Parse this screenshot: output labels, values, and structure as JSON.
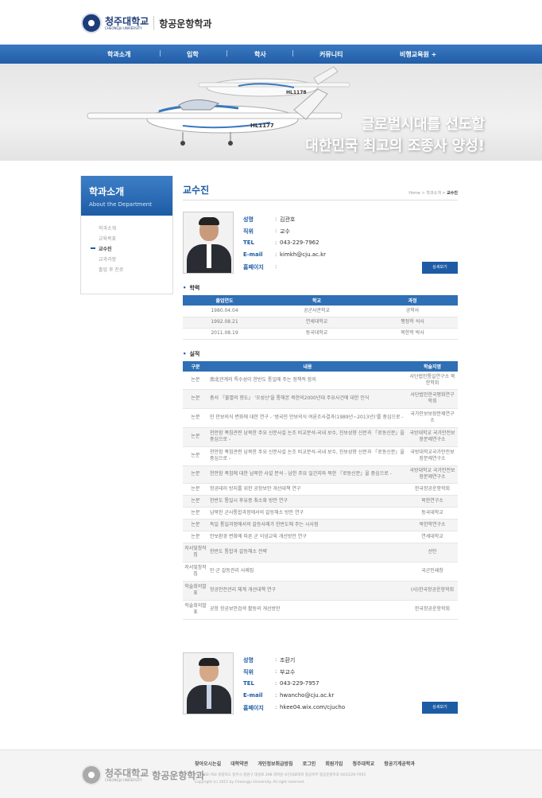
{
  "header": {
    "univ_ko": "청주대학교",
    "univ_en": "CHEONGJU UNIVERSITY",
    "dept": "항공운항학과",
    "nav": [
      "학과소개",
      "입학",
      "학사",
      "커뮤니티",
      "비행교육원 +"
    ]
  },
  "hero": {
    "line1": "글로벌시대를 선도할",
    "line2": "대한민국 최고의 조종사 양성!",
    "plane_front": "HL1177",
    "plane_back": "HL1178"
  },
  "sidebar": {
    "title": "학과소개",
    "subtitle": "About the Department",
    "items": [
      "학과소개",
      "교육목표",
      "교수진",
      "교과과정",
      "졸업 후 진로"
    ],
    "active": 2
  },
  "page": {
    "title": "교수진",
    "breadcrumb": [
      "Home",
      "학과소개",
      "교수진"
    ],
    "crumb_sep": ">"
  },
  "labels": {
    "name": "성명",
    "position": "직위",
    "tel": "TEL",
    "email": "E-mail",
    "homepage": "홈페이지",
    "detail_button": "상세보기",
    "colon": ":"
  },
  "professors": [
    {
      "name": "김관호",
      "position": "교수",
      "tel": "043-229-7962",
      "email": "kimkh@cju.ac.kr",
      "homepage": "",
      "education": {
        "title": "학력",
        "headers": [
          "졸업연도",
          "학교",
          "과정"
        ],
        "rows": [
          [
            "1980.04.04",
            "공군사관학교",
            "공학사"
          ],
          [
            "1992.08.21",
            "연세대학교",
            "행정학 석사"
          ],
          [
            "2011.08.19",
            "동국대학교",
            "북한학 박사"
          ]
        ]
      },
      "achievements": {
        "title": "실적",
        "headers": [
          "구분",
          "내용",
          "학술지명"
        ],
        "rows": [
          [
            "논문",
            "南北관계의 특수성이 한반도 통일에 주는 정책적 함의",
            "사단법인통일연구소 북한학회"
          ],
          [
            "논문",
            "총서 『불멸의 향도』 '오성산'을 통해본 북한의2000년대 주요사건에 대한 인식",
            "사단법인한국평화연구학회"
          ],
          [
            "논문",
            "민 안보의식 변화에 대한 연구 - '범국민 안보의식 여론조사결과(1989년~2013년)'를 중심으로 -",
            "국가안보보장문제연구소"
          ],
          [
            "논문",
            "천안함 폭침관련 남북한 주요 신문사설 논조 비교분석-국내 보수, 진보성향 신문과 『로동신문』을 중심으로 -",
            "국방대학교 국가안전보장문제연구소"
          ],
          [
            "논문",
            "천안함 폭침관련 남북한 주요 신문사설 논조 비교분석-국내 보수, 진보성향 신문과 『로동신문』을 중심으로 -",
            "국방대학교국가안전보장문제연구소"
          ],
          [
            "논문",
            "천안함 폭침에 대한 남북한 사설 분석 - 남한 주요 일간지와 북한 『로동신문』을 중심으로 -",
            "국방대학교 국가안전보장문제연구소"
          ],
          [
            "논문",
            "항공테러 방지를 위한 공항보안 개선대책 연구",
            "한국항공운항학회"
          ],
          [
            "논문",
            "한반도 통일시 후유증 최소화 방안 연구",
            "북한연구소"
          ],
          [
            "논문",
            "남북한 군사통합과정에서의 갈등해소 방안 연구",
            "동국대학교"
          ],
          [
            "논문",
            "독일 통일과정에서의 갈등사례가 한반도에 주는 시사점",
            "북한학연구소"
          ],
          [
            "논문",
            "안보환경 변화에 따른 군 이념교육 개선방안 연구",
            "연세대학교"
          ],
          [
            "저서및창작집",
            "한반도 통합과 갈등해소 전략",
            "선인"
          ],
          [
            "저서및창작집",
            "민·군 갈등관리 사례집",
            "국군인쇄창"
          ],
          [
            "학술회의발표",
            "항공안전관리 체계 개선대책 연구",
            "(사)한국항공운항학회"
          ],
          [
            "학술회의발표",
            "공항 항공보안검색 활동의 개선방안",
            "한국항공운항학회"
          ]
        ]
      }
    },
    {
      "name": "조환기",
      "position": "부교수",
      "tel": "043-229-7957",
      "email": "hwancho@cju.ac.kr",
      "homepage": "hkee04.wix.com/cjucho"
    }
  ],
  "footer": {
    "links": [
      "찾아오시는길",
      "대학약관",
      "개인정보취급방침",
      "로그인",
      "회원가입",
      "청주대학교",
      "항공기계공학과"
    ],
    "address": "(우) 360-764 충청북도 청주시 청원구 대성로 298 대학원 보건의료대학 항공학부 항공운항학과 043)229-7955",
    "copyright": "Copyright (c) 2012 by Cheongju University. All right reserved."
  },
  "colors": {
    "brand_blue": "#1d5ca5",
    "nav_blue": "#2f6fb5",
    "footer_bg": "#f4f4f4"
  }
}
